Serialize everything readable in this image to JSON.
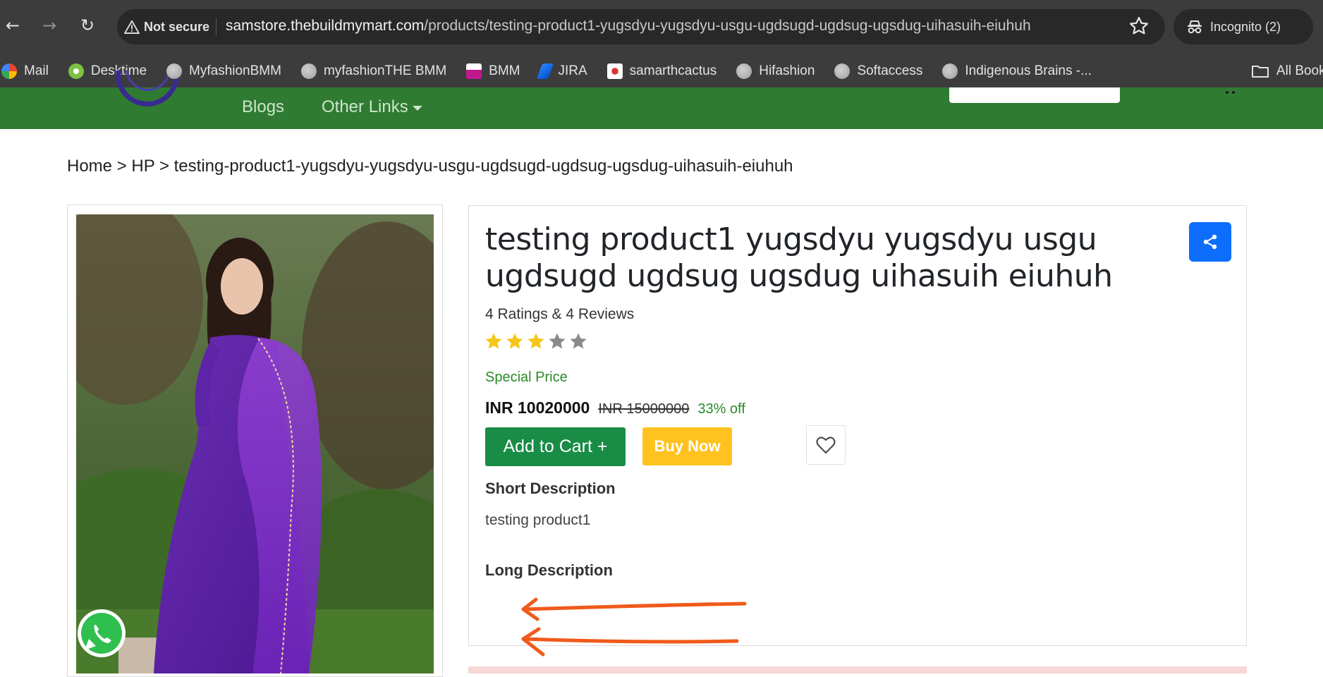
{
  "browser": {
    "security_label": "Not secure",
    "url_host": "samstore.thebuildmymart.com",
    "url_path": "/products/testing-product1-yugsdyu-yugsdyu-usgu-ugdsugd-ugdsug-ugsdug-uihasuih-eiuhuh",
    "incognito_label": "Incognito (2)",
    "bookmarks": [
      {
        "label": "Mail",
        "icon": "google-icon"
      },
      {
        "label": "Desktime",
        "icon": "desktime-icon"
      },
      {
        "label": "MyfashionBMM",
        "icon": "globe-icon"
      },
      {
        "label": "myfashionTHE BMM",
        "icon": "globe-icon"
      },
      {
        "label": "BMM",
        "icon": "bmm-icon"
      },
      {
        "label": "JIRA",
        "icon": "jira-icon"
      },
      {
        "label": "samarthcactus",
        "icon": "samarth-icon"
      },
      {
        "label": "Hifashion",
        "icon": "globe-icon"
      },
      {
        "label": "Softaccess",
        "icon": "globe-icon"
      },
      {
        "label": "Indigenous Brains -...",
        "icon": "globe-icon"
      }
    ],
    "all_bookmarks_label": "All Bookmarks"
  },
  "header": {
    "nav": {
      "blogs": "Blogs",
      "other_links": "Other Links"
    },
    "brand_color": "#2f7b31"
  },
  "breadcrumb": "Home > HP > testing-product1-yugsdyu-yugsdyu-usgu-ugdsugd-ugdsug-ugsdug-uihasuih-eiuhuh",
  "product": {
    "title": "testing product1 yugsdyu yugsdyu usgu ugdsugd ugdsug ugsdug uihasuih eiuhuh",
    "ratings_text": "4 Ratings & 4 Reviews",
    "rating": 3,
    "rating_max": 5,
    "special_price_label": "Special Price",
    "price": "INR 10020000",
    "mrp": "INR 15000000",
    "discount": "33% off",
    "add_to_cart_label": "Add to Cart +",
    "buy_now_label": "Buy Now",
    "short_description_heading": "Short Description",
    "short_description": "testing product1",
    "long_description_heading": "Long Description"
  },
  "colors": {
    "add_to_cart": "#198c45",
    "buy_now": "#ffc21f",
    "share": "#0d6efd",
    "star_filled": "#f5c518",
    "star_empty": "#8a8a8a",
    "annotation": "#f05a1a"
  }
}
